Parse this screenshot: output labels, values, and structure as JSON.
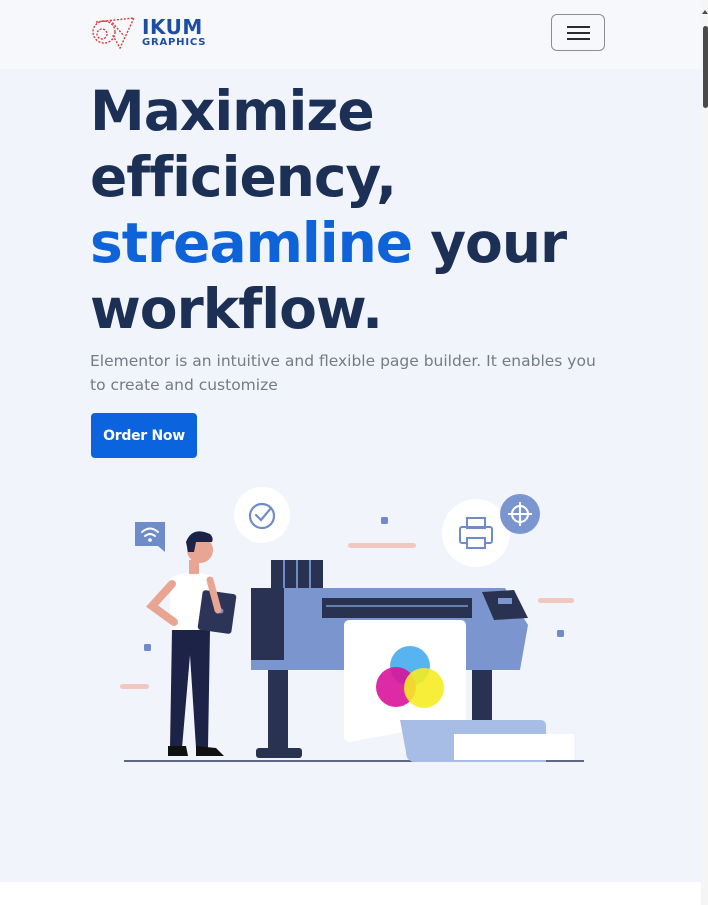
{
  "brand": {
    "name": "IKUM",
    "tagline": "GRAPHICS",
    "color": "#1c4ea8",
    "mark_color": "#d83a3a"
  },
  "nav": {
    "toggle_icon": "hamburger-menu-icon"
  },
  "hero": {
    "title_line1": "Maximize",
    "title_line2": "efficiency,",
    "title_accent": "streamline",
    "title_line3_rest": " your",
    "title_line4": "workflow.",
    "description": "Elementor is an intuitive and flexible page builder. It enables you to create and customize",
    "cta_label": "Order Now",
    "accent_color": "#0f63d9",
    "title_color": "#1c2f55"
  },
  "illustration": {
    "subject": "person-with-tablet-and-large-format-printer",
    "icons": [
      "wifi-icon",
      "clock-check-icon",
      "printer-icon",
      "crosshair-icon"
    ]
  }
}
